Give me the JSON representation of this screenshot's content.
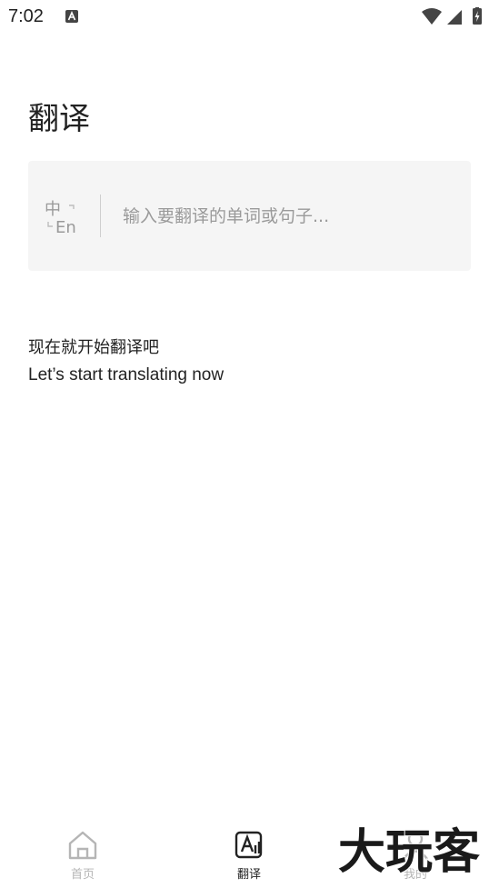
{
  "status_bar": {
    "time": "7:02",
    "icons": [
      "notification-a-icon",
      "wifi-icon",
      "signal-icon",
      "battery-charging-icon"
    ]
  },
  "page": {
    "title": "翻译"
  },
  "translate_input": {
    "lang_badge_top": "中",
    "lang_badge_bottom": "En",
    "placeholder": "输入要翻译的单词或句子...",
    "value": ""
  },
  "prompt": {
    "line_cn": "现在就开始翻译吧",
    "line_en": "Let’s start translating now"
  },
  "bottom_nav": {
    "items": [
      {
        "label": "首页",
        "icon": "home-icon",
        "active": false
      },
      {
        "label": "翻译",
        "icon": "translate-icon",
        "active": true
      },
      {
        "label": "我的",
        "icon": "profile-icon",
        "active": false
      }
    ]
  },
  "watermark": {
    "text": "大玩客"
  },
  "colors": {
    "text_primary": "#222222",
    "text_placeholder": "#9a9a9a",
    "card_bg": "#f5f5f5",
    "nav_inactive": "#b5b5b5"
  }
}
